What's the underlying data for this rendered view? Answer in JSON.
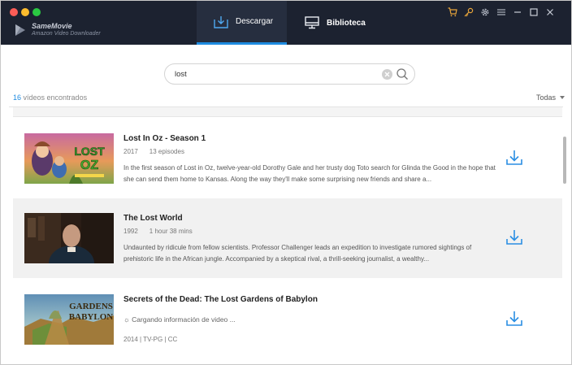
{
  "app": {
    "name": "SameMovie",
    "subtitle": "Amazon Video Downloader",
    "accent": "#1e8be0"
  },
  "tabs": [
    {
      "label": "Descargar",
      "icon": "download-tray-icon",
      "active": true
    },
    {
      "label": "Biblioteca",
      "icon": "monitor-icon",
      "active": false
    }
  ],
  "toolbar": {
    "icons": [
      "cart-icon",
      "key-icon",
      "gear-icon",
      "menu-icon",
      "minimize-icon",
      "maximize-icon",
      "close-icon"
    ]
  },
  "search": {
    "value": "lost",
    "clear_icon": "clear-icon",
    "search_icon": "search-icon"
  },
  "results": {
    "count": "16",
    "count_label": " vídeos encontrados",
    "filter_label": "Todas"
  },
  "videos": [
    {
      "title": "Lost In Oz - Season 1",
      "year": "2017",
      "detail": "13 episodes",
      "description": "In the first season of Lost in Oz, twelve-year-old Dorothy Gale and her trusty dog Toto search for Glinda the Good in the hope that she can send them home to Kansas. Along the way they'll make some surprising new friends and share a...",
      "thumb_badge": "AMAZON ORIGINAL",
      "thumb_title": "LOST IN OZ"
    },
    {
      "title": "The Lost World",
      "year": "1992",
      "detail": "1 hour 38 mins",
      "description": "Undaunted by ridicule from fellow scientists. Professor Challenger leads an expedition to investigate rumored sightings of prehistoric life in the African jungle. Accompanied by a skeptical rival, a thrill-seeking journalist, a wealthy..."
    },
    {
      "title": "Secrets of the Dead: The Lost Gardens of Babylon",
      "loading": "Cargando información de video ...",
      "meta": "2014 | TV-PG | CC",
      "thumb_title": "GARDENS BABYLON"
    }
  ]
}
